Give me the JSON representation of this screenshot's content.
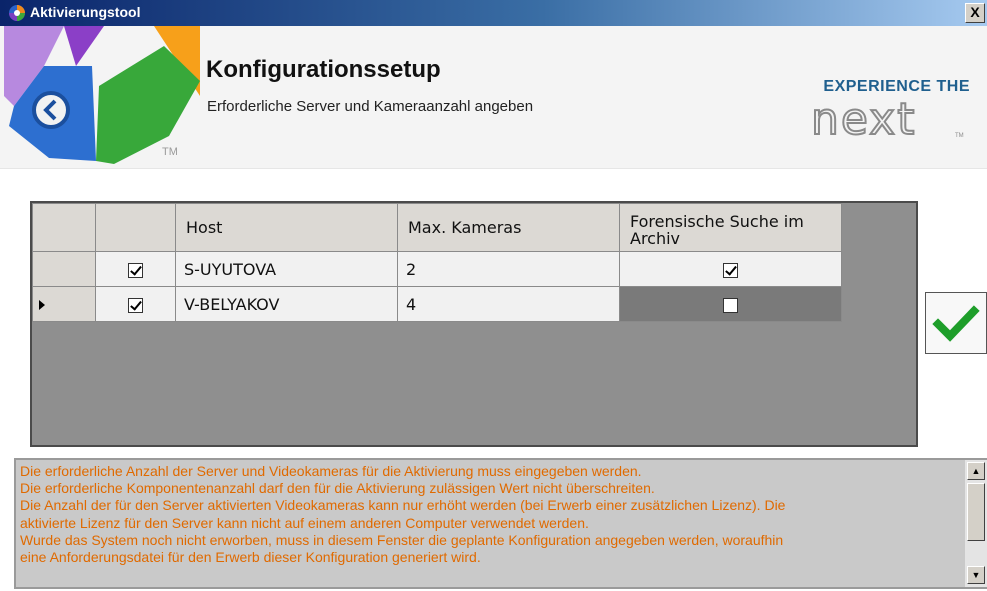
{
  "window": {
    "title": "Aktivierungstool",
    "close_label": "X"
  },
  "header": {
    "title": "Konfigurationssetup",
    "subtitle": "Erforderliche Server und Kameraanzahl angeben",
    "tm": "TM",
    "brand_tagline": "EXPERIENCE THE",
    "brand_name": "next",
    "brand_tm": "TM"
  },
  "grid": {
    "columns": [
      "",
      "",
      "Host",
      "Max. Kameras",
      "Forensische Suche im Archiv"
    ],
    "rows": [
      {
        "current": false,
        "enabled": true,
        "host": "S-UYUTOVA",
        "max_cameras": "2",
        "forensic": true
      },
      {
        "current": true,
        "enabled": true,
        "host": "V-BELYAKOV",
        "max_cameras": "4",
        "forensic": false
      }
    ]
  },
  "info": {
    "lines": [
      "Die erforderliche Anzahl der Server und Videokameras für die Aktivierung muss eingegeben werden.",
      "Die erforderliche Komponentenanzahl darf den für die Aktivierung zulässigen Wert nicht überschreiten.",
      "Die Anzahl der für den Server aktivierten Videokameras kann nur erhöht werden (bei Erwerb einer zusätzlichen Lizenz). Die",
      "aktivierte Lizenz für den Server kann nicht auf einem anderen Computer verwendet werden.",
      "Wurde das System noch nicht erworben, muss in diesem Fenster die geplante Konfiguration angegeben werden, woraufhin",
      "eine Anforderungsdatei für den Erwerb dieser Konfiguration generiert wird."
    ]
  },
  "icons": {
    "app": "app-logo-icon",
    "back": "back-arrow-icon",
    "confirm": "checkmark-icon",
    "scroll_up": "scroll-up-icon",
    "scroll_down": "scroll-down-icon"
  },
  "colors": {
    "info_text": "#e06a00",
    "confirm_check": "#1e9e2a",
    "brand_blue": "#1f5f8e",
    "grid_background": "#8f8f8f"
  }
}
